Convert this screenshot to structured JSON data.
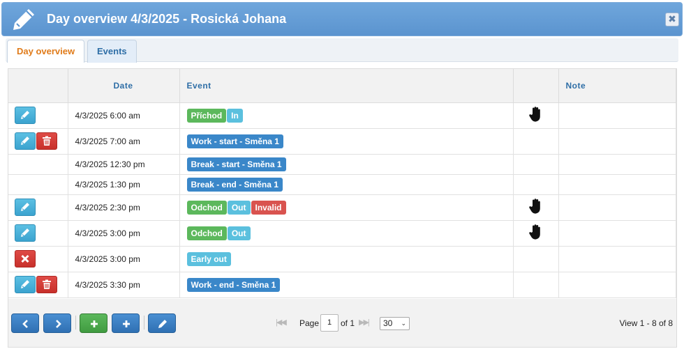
{
  "window": {
    "title": "Day overview 4/3/2025 - Rosická Johana",
    "close_label": "✖"
  },
  "tabs": [
    {
      "label": "Day overview",
      "active": true
    },
    {
      "label": "Events",
      "active": false
    }
  ],
  "table": {
    "columns": [
      "",
      "Date",
      "Event",
      "",
      "Note"
    ],
    "rows": [
      {
        "actions": [
          "edit"
        ],
        "date": "4/3/2025 6:00 am",
        "labels": [
          {
            "text": "Příchod",
            "color": "green"
          },
          {
            "text": "In",
            "color": "cyan"
          }
        ],
        "hand": true,
        "note": ""
      },
      {
        "actions": [
          "edit",
          "delete"
        ],
        "date": "4/3/2025 7:00 am",
        "labels": [
          {
            "text": "Work - start - Směna 1",
            "color": "blue"
          }
        ],
        "hand": false,
        "note": ""
      },
      {
        "actions": [],
        "date": "4/3/2025 12:30 pm",
        "labels": [
          {
            "text": "Break - start - Směna 1",
            "color": "blue"
          }
        ],
        "hand": false,
        "note": ""
      },
      {
        "actions": [],
        "date": "4/3/2025 1:30 pm",
        "labels": [
          {
            "text": "Break - end - Směna 1",
            "color": "blue"
          }
        ],
        "hand": false,
        "note": ""
      },
      {
        "actions": [
          "edit"
        ],
        "date": "4/3/2025 2:30 pm",
        "labels": [
          {
            "text": "Odchod",
            "color": "green"
          },
          {
            "text": "Out",
            "color": "cyan"
          },
          {
            "text": "Invalid",
            "color": "red"
          }
        ],
        "hand": true,
        "note": ""
      },
      {
        "actions": [
          "edit"
        ],
        "date": "4/3/2025 3:00 pm",
        "labels": [
          {
            "text": "Odchod",
            "color": "green"
          },
          {
            "text": "Out",
            "color": "cyan"
          }
        ],
        "hand": true,
        "note": ""
      },
      {
        "actions": [
          "cancel"
        ],
        "date": "4/3/2025 3:00 pm",
        "labels": [
          {
            "text": "Early out",
            "color": "cyan"
          }
        ],
        "hand": false,
        "note": ""
      },
      {
        "actions": [
          "edit",
          "delete"
        ],
        "date": "4/3/2025 3:30 pm",
        "labels": [
          {
            "text": "Work - end - Směna 1",
            "color": "blue"
          }
        ],
        "hand": false,
        "note": ""
      }
    ]
  },
  "pager": {
    "buttons": [
      "prev-icon",
      "next-icon",
      "add-icon",
      "add-icon",
      "edit-icon"
    ],
    "first_glyph": "|◀◀",
    "last_glyph": "▶▶|",
    "page_label": "Page",
    "page_value": "1",
    "of_label": "of 1",
    "page_size": "30",
    "view_text": "View 1 - 8 of 8"
  },
  "colors": {
    "green": "#5cb85c",
    "cyan": "#5bc0de",
    "blue": "#3a87c9",
    "red": "#d9534f",
    "title_bar": "#5b94cf",
    "active_tab": "#e07b1a"
  }
}
